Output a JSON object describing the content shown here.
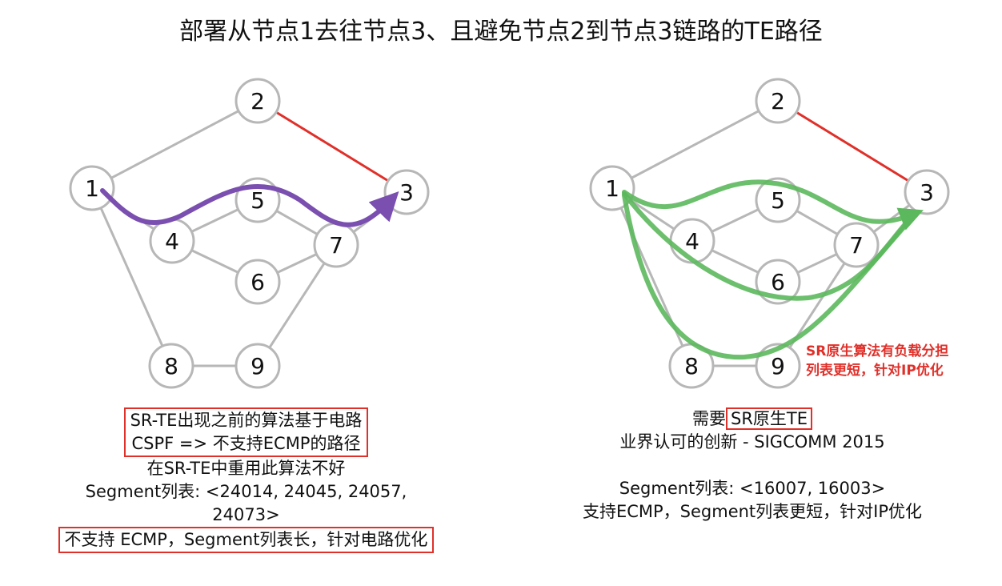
{
  "title": "部署从节点1去往节点3、且避免节点2到节点3链路的TE路径",
  "colors": {
    "edge": "#b7b7b7",
    "avoid_link": "#e0302a",
    "left_path": "#7a4fb0",
    "right_path": "#5cb85c",
    "highlight_box": "#e0302a"
  },
  "graphs": [
    {
      "nodes": [
        "1",
        "2",
        "3",
        "4",
        "5",
        "6",
        "7",
        "8",
        "9"
      ],
      "avoided_link": [
        "2",
        "3"
      ],
      "path_nodes": [
        "1",
        "4",
        "5",
        "7",
        "3"
      ]
    },
    {
      "nodes": [
        "1",
        "2",
        "3",
        "4",
        "5",
        "6",
        "7",
        "8",
        "9"
      ],
      "avoided_link": [
        "2",
        "3"
      ],
      "ecmp_paths": [
        [
          "1",
          "4",
          "5",
          "7",
          "3"
        ],
        [
          "1",
          "4",
          "6",
          "7",
          "3"
        ],
        [
          "1",
          "8",
          "9",
          "7",
          "3"
        ]
      ]
    }
  ],
  "left_caption": {
    "line1": "SR-TE出现之前的算法基于电路",
    "line2": "CSPF => 不支持ECMP的路径",
    "line3": "在SR-TE中重用此算法不好",
    "line4": "Segment列表: <24014, 24045, 24057,",
    "line5": "24073>",
    "line6": "不支持 ECMP，Segment列表长，针对电路优化"
  },
  "right_caption": {
    "line1_prefix": "需要",
    "line1_boxed": "SR原生TE",
    "line2": "业界认可的创新 - SIGCOMM 2015",
    "line4": "Segment列表: <16007, 16003>",
    "line5": "支持ECMP，Segment列表更短，针对IP优化"
  },
  "annotation": {
    "line1": "SR原生算法有负载分担",
    "line2": "列表更短，针对IP优化"
  }
}
